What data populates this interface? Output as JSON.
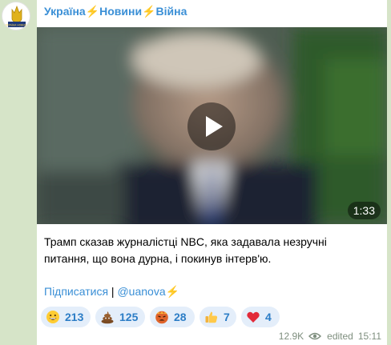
{
  "channel": {
    "name": "Україна⚡Новини⚡Війна",
    "avatar_text": "УКРАЇНА НОВИНИ"
  },
  "video": {
    "duration": "1:33"
  },
  "message": {
    "text": "Трамп сказав журналістці NBC, яка задавала незручні питання, що вона дурна, і покинув інтерв'ю."
  },
  "subscribe": {
    "link_label": "Підписатися",
    "separator": " | ",
    "handle": "@uanova⚡"
  },
  "reactions": [
    {
      "icon": "grinning-face-icon",
      "count": "213"
    },
    {
      "icon": "poop-icon",
      "count": "125"
    },
    {
      "icon": "angry-face-icon",
      "count": "28"
    },
    {
      "icon": "thumbs-up-icon",
      "count": "7"
    },
    {
      "icon": "red-heart-icon",
      "count": "4"
    }
  ],
  "meta": {
    "views": "12.9K",
    "edited_label": "edited",
    "time": "15:11"
  },
  "colors": {
    "accent": "#3a8fd6",
    "reaction_bg": "#e4eefa",
    "chat_background": "#d6e4c8"
  }
}
